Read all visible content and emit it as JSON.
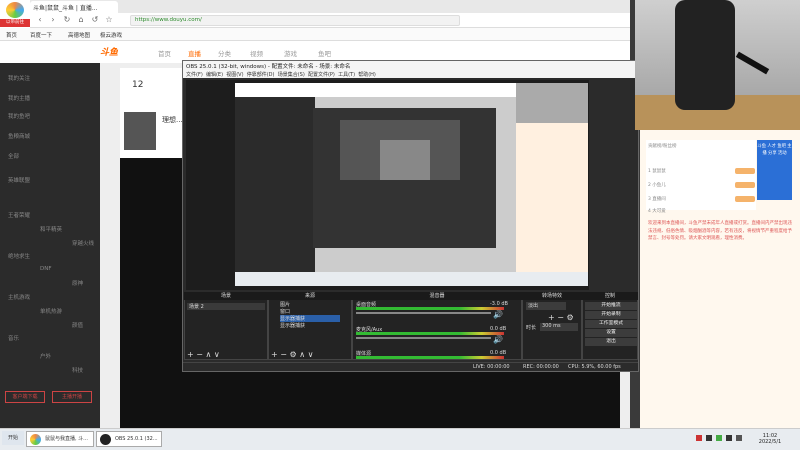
{
  "browser": {
    "logo": "以带前往",
    "tab_title": "斗鱼|鼠鼠_斗鱼 | 直播...",
    "url": "https://www.douyu.com/",
    "bookmarks": [
      "首页",
      "百度一下",
      "高德地图",
      "极云游戏"
    ]
  },
  "site": {
    "logo": "斗鱼",
    "nav": [
      "首页",
      "直播",
      "分类",
      "视频",
      "游戏",
      "鱼吧"
    ],
    "room_count": "12",
    "room_title": "理想...",
    "sidebar": [
      "我的关注",
      "我的主播",
      "我的鱼吧",
      "鱼粮商城",
      "全部",
      "英雄联盟",
      "王者荣耀",
      "和平精英",
      "穿越火线",
      "绝地求生",
      "DNF",
      "原神",
      "主机游戏",
      "单机热游",
      "颜值",
      "音乐",
      "户外",
      "科技"
    ],
    "sidebar_buttons": [
      "客户端下载",
      "主播开播"
    ]
  },
  "obs": {
    "title": "OBS 25.0.1 (32-bit, windows) - 配置文件: 未命名 - 场景: 未命名",
    "menu": [
      "文件(F)",
      "编辑(E)",
      "视图(V)",
      "停靠部件(D)",
      "场景集合(S)",
      "配置文件(P)",
      "工具(T)",
      "帮助(H)"
    ],
    "docks": {
      "scenes": "场景",
      "sources": "来源",
      "mixer": "混音器",
      "transitions": "转场特效",
      "controls": "控制"
    },
    "scene_item": "场景 2",
    "source_items": [
      "图片",
      "窗口",
      "显示器捕获",
      "显示器捕获"
    ],
    "mixer_channels": [
      {
        "name": "桌面音频",
        "db": "-3.0 dB"
      },
      {
        "name": "麦克风/Aux",
        "db": "0.0 dB"
      },
      {
        "name": "媒体源",
        "db": "0.0 dB"
      }
    ],
    "transition": "淡出",
    "duration_label": "时长",
    "duration_value": "300 ms",
    "controls": [
      "开始推流",
      "开始录制",
      "工作室模式",
      "设置",
      "退出"
    ],
    "status": {
      "live": "LIVE: 00:00:00",
      "rec": "REC: 00:00:00",
      "cpu": "CPU: 5.9%, 60.00 fps"
    }
  },
  "chat": {
    "header": "贡献榜/粉丝榜",
    "lines": [
      "1 鼠鼠鼠",
      "2 小鱼儿",
      "3 直播间",
      "4 大可爱"
    ],
    "message": "欢迎来到本直播间，斗鱼严禁未成年人直播或打赏。直播间内严禁出现违法违规、低俗色情、吸烟酗酒等内容，若有违反，将视情节严重程度给予禁言、封号等处罚。请大家文明观看，理性消费。",
    "banner": "斗鱼 人才 鱼吧 主播 分享 活动"
  },
  "taskbar": {
    "start": "开始",
    "tasks": [
      "鼠鼠与我直播, 斗...",
      "OBS 25.0.1 (32..."
    ],
    "time": "11:02",
    "date": "2022/5/1"
  },
  "colors": {
    "accent": "#ff6a00",
    "obs_bg": "#2b2b2b"
  }
}
